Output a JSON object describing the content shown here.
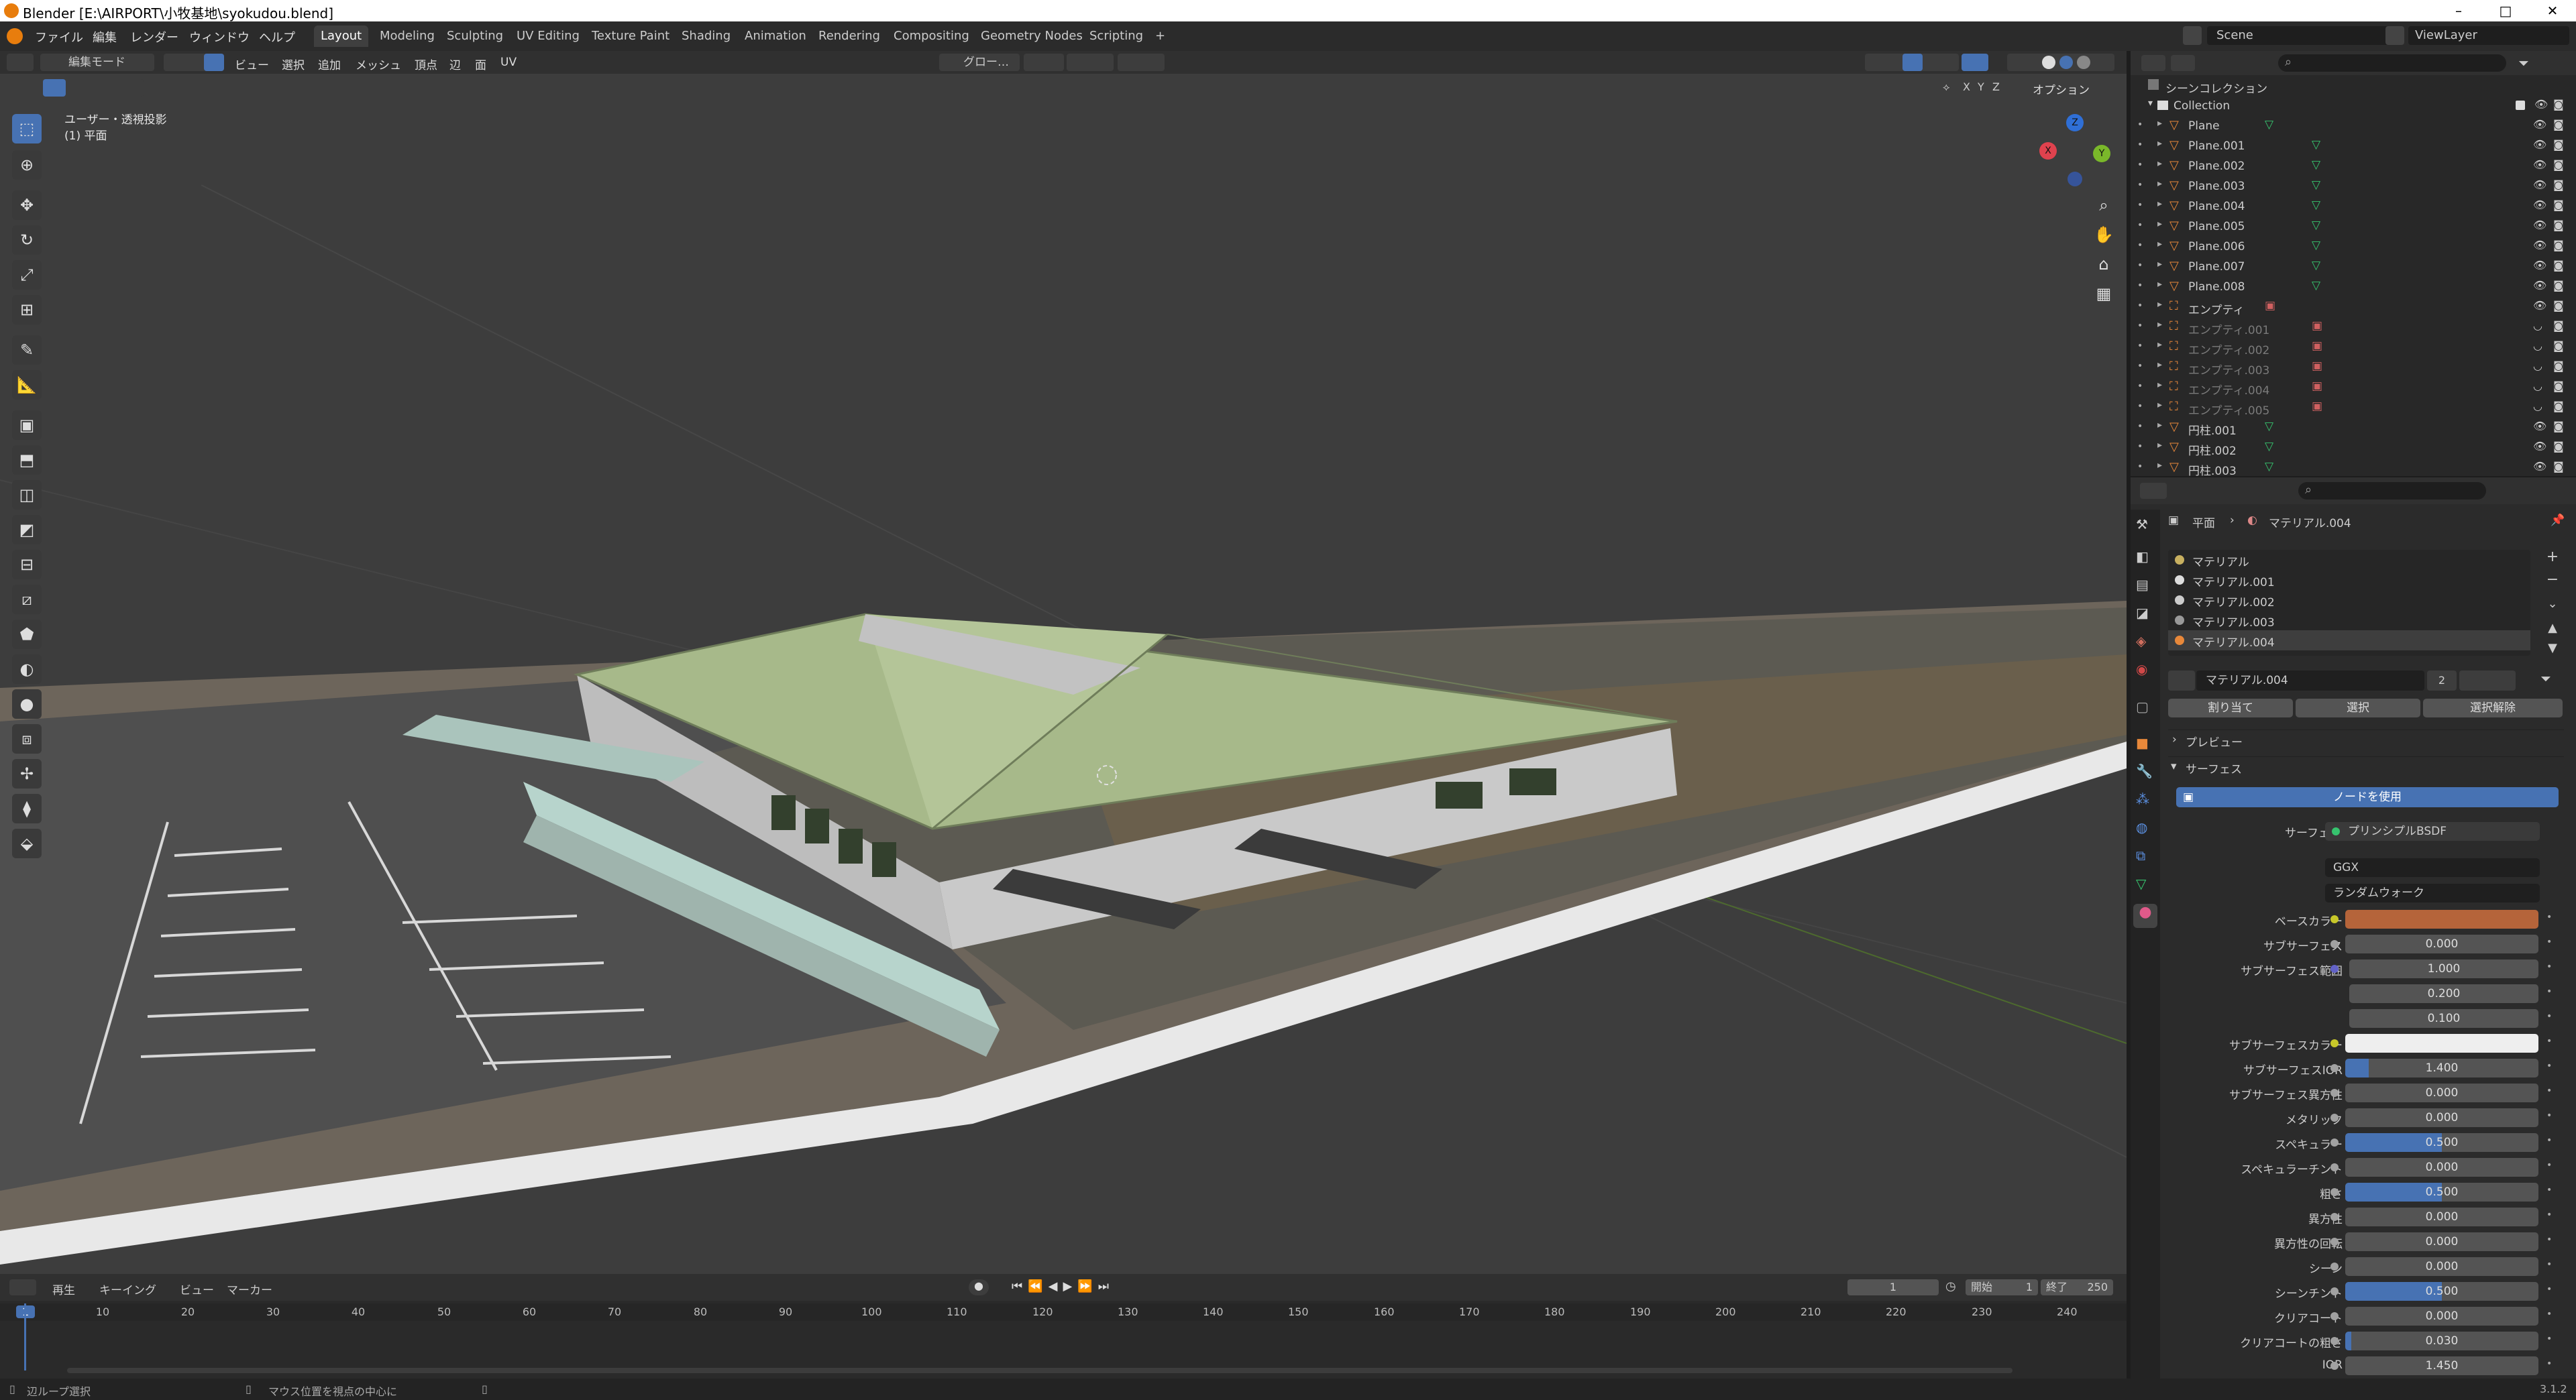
{
  "window": {
    "title": "Blender [E:\\AIRPORT\\小牧基地\\syokudou.blend]",
    "minimize": "–",
    "maximize": "□",
    "close": "✕"
  },
  "menu": [
    "ファイル",
    "編集",
    "レンダー",
    "ウィンドウ",
    "ヘルプ"
  ],
  "workspaces": [
    "Layout",
    "Modeling",
    "Sculpting",
    "UV Editing",
    "Texture Paint",
    "Shading",
    "Animation",
    "Rendering",
    "Compositing",
    "Geometry Nodes",
    "Scripting",
    "+"
  ],
  "scene": {
    "label": "Scene",
    "viewlayer": "ViewLayer"
  },
  "viewport_header": {
    "mode": "編集モード",
    "items": [
      "ビュー",
      "選択",
      "追加",
      "メッシュ",
      "頂点",
      "辺",
      "面",
      "UV"
    ],
    "transform": "グロー…",
    "options": "オプション",
    "axes": [
      "X",
      "Y",
      "Z"
    ]
  },
  "viewport": {
    "view_name": "ユーザー・透視投影",
    "object_name": "(1) 平面"
  },
  "gizmo": {
    "x": "X",
    "y": "Y",
    "z": "Z"
  },
  "outliner": {
    "scene_collection": "シーンコレクション",
    "collection": "Collection",
    "items": [
      {
        "name": "Plane",
        "dim": false
      },
      {
        "name": "Plane.001",
        "dim": false
      },
      {
        "name": "Plane.002",
        "dim": false
      },
      {
        "name": "Plane.003",
        "dim": false
      },
      {
        "name": "Plane.004",
        "dim": false
      },
      {
        "name": "Plane.005",
        "dim": false
      },
      {
        "name": "Plane.006",
        "dim": false
      },
      {
        "name": "Plane.007",
        "dim": false
      },
      {
        "name": "Plane.008",
        "dim": false
      },
      {
        "name": "エンプティ",
        "dim": false
      },
      {
        "name": "エンプティ.001",
        "dim": true
      },
      {
        "name": "エンプティ.002",
        "dim": true
      },
      {
        "name": "エンプティ.003",
        "dim": true
      },
      {
        "name": "エンプティ.004",
        "dim": true
      },
      {
        "name": "エンプティ.005",
        "dim": true
      },
      {
        "name": "円柱.001",
        "dim": false
      },
      {
        "name": "円柱.002",
        "dim": false
      },
      {
        "name": "円柱.003",
        "dim": false
      }
    ]
  },
  "properties": {
    "breadcrumb_object": "平面",
    "breadcrumb_material": "マテリアル.004",
    "slots": [
      "マテリアル",
      "マテリアル.001",
      "マテリアル.002",
      "マテリアル.003",
      "マテリアル.004"
    ],
    "active_material": "マテリアル.004",
    "users": "2",
    "assign": "割り当て",
    "select": "選択",
    "deselect": "選択解除",
    "preview": "プレビュー",
    "surface_panel": "サーフェス",
    "use_nodes": "ノードを使用",
    "surface_label": "サーフェス",
    "surface_value": "プリンシプルBSDF",
    "distribution": "GGX",
    "subsurface_method": "ランダムウォーク",
    "fields": [
      {
        "label": "ベースカラー",
        "value": "",
        "color": "#b5643a"
      },
      {
        "label": "サブサーフェス",
        "value": "0.000"
      },
      {
        "label": "サブサーフェス範囲",
        "value": "1.000"
      },
      {
        "label": "",
        "value": "0.200"
      },
      {
        "label": "",
        "value": "0.100"
      },
      {
        "label": "サブサーフェスカラー",
        "value": "",
        "color": "#eeeeee"
      },
      {
        "label": "サブサーフェスIOR",
        "value": "1.400",
        "fill": 0.12
      },
      {
        "label": "サブサーフェス異方性",
        "value": "0.000"
      },
      {
        "label": "メタリック",
        "value": "0.000"
      },
      {
        "label": "スペキュラー",
        "value": "0.500",
        "fill": 0.5
      },
      {
        "label": "スペキュラーチント",
        "value": "0.000"
      },
      {
        "label": "粗さ",
        "value": "0.500",
        "fill": 0.5
      },
      {
        "label": "異方性",
        "value": "0.000"
      },
      {
        "label": "異方性の回転",
        "value": "0.000"
      },
      {
        "label": "シーン",
        "value": "0.000"
      },
      {
        "label": "シーンチント",
        "value": "0.500",
        "fill": 0.5
      },
      {
        "label": "クリアコート",
        "value": "0.000"
      },
      {
        "label": "クリアコートの粗さ",
        "value": "0.030",
        "fill": 0.03
      },
      {
        "label": "IOR",
        "value": "1.450"
      }
    ]
  },
  "timeline": {
    "menus": [
      "再生",
      "キーイング",
      "ビュー",
      "マーカー"
    ],
    "current_frame": "1",
    "start_label": "開始",
    "start": "1",
    "end_label": "終了",
    "end": "250",
    "ticks": [
      "1",
      "10",
      "20",
      "30",
      "40",
      "50",
      "60",
      "70",
      "80",
      "90",
      "100",
      "110",
      "120",
      "130",
      "140",
      "150",
      "160",
      "170",
      "180",
      "190",
      "200",
      "210",
      "220",
      "230",
      "240"
    ]
  },
  "status": {
    "left": "辺ループ選択",
    "middle": "マウス位置を視点の中心に",
    "version": "3.1.2"
  },
  "colors": {
    "accent": "#4772b3",
    "roof": "#a7b98a",
    "wall": "#c9c9c9"
  }
}
